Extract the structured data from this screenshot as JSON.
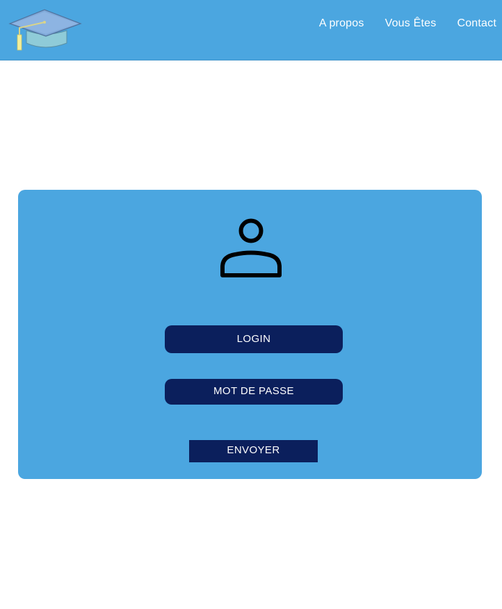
{
  "nav": {
    "items": [
      {
        "label": "A propos"
      },
      {
        "label": "Vous Êtes"
      },
      {
        "label": "Contact"
      }
    ]
  },
  "logo": {
    "icon": "graduation-cap-icon"
  },
  "login_card": {
    "user_icon": "user-icon",
    "login_placeholder": "LOGIN",
    "password_placeholder": "MOT DE PASSE",
    "submit_label": "ENVOYER"
  },
  "colors": {
    "header_bg": "#4ba6e0",
    "card_bg": "#4ba6e0",
    "field_bg": "#0b1f5c",
    "text": "#ffffff"
  }
}
